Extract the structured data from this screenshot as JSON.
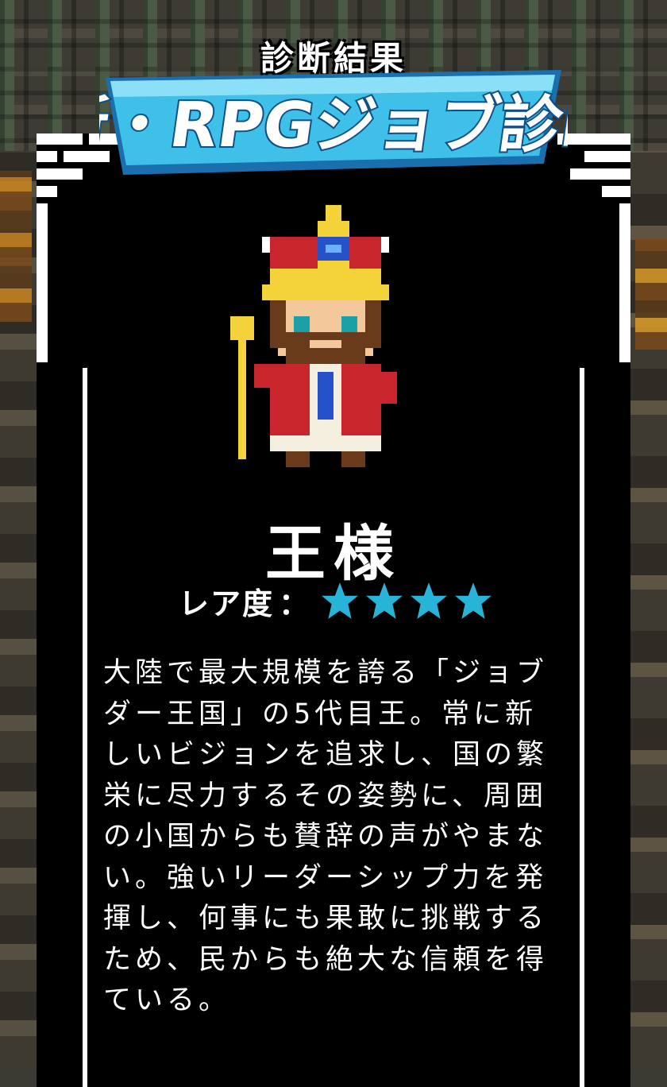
{
  "header": {
    "subtitle": "診断結果",
    "logo_text": "新・RPGジョブ診断"
  },
  "result": {
    "job_name": "王様",
    "rarity_label": "レア度",
    "rarity_separator": "：",
    "rarity_stars": 4,
    "star_color": "#27b4d8",
    "description": "大陸で最大規模を誇る「ジョブダー王国」の5代目王。常に新しいビジョンを追求し、国の繁栄に尽力するその姿勢に、周囲の小国からも賛辞の声がやまない。強いリーダーシップ力を発揮し、何事にも果敢に挑戦するため、民からも絶大な信頼を得ている。",
    "character_icon": "king-sprite-icon"
  },
  "colors": {
    "panel_bg": "#000000",
    "text": "#ffffff",
    "logo_fill": "#3ec0e8",
    "logo_shadow": "#1a6fae"
  }
}
